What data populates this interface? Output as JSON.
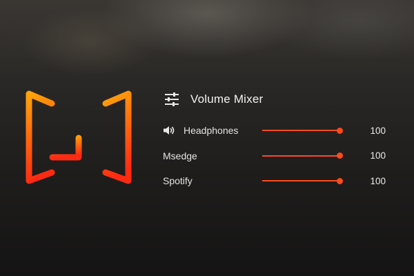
{
  "logo": {
    "icon": "equalizer-brackets-logo",
    "colors": {
      "top": "#ffa40a",
      "bottom": "#ff2a12"
    }
  },
  "mixer": {
    "icon": "sliders-icon",
    "title": "Volume Mixer",
    "accent": "#ff4a1c",
    "rows": [
      {
        "label": "Headphones",
        "icon": "speaker-icon",
        "value": "100",
        "level": 1.0
      },
      {
        "label": "Msedge",
        "value": "100",
        "level": 1.0
      },
      {
        "label": "Spotify",
        "value": "100",
        "level": 1.0
      }
    ]
  }
}
